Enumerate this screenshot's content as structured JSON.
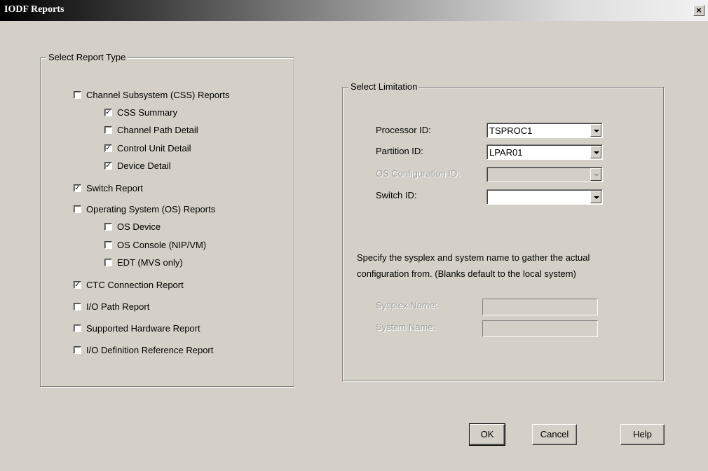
{
  "window": {
    "title": "IODF Reports",
    "close_glyph": "×"
  },
  "report_type": {
    "group_label": "Select Report Type",
    "items": [
      {
        "label": "Channel Subsystem (CSS) Reports",
        "checked": false
      },
      {
        "label": "CSS Summary",
        "checked": true
      },
      {
        "label": "Channel Path Detail",
        "checked": false
      },
      {
        "label": "Control Unit Detail",
        "checked": true
      },
      {
        "label": "Device Detail",
        "checked": true
      },
      {
        "label": "Switch Report",
        "checked": true
      },
      {
        "label": "Operating System (OS) Reports",
        "checked": false
      },
      {
        "label": "OS Device",
        "checked": false
      },
      {
        "label": "OS Console (NIP/VM)",
        "checked": false
      },
      {
        "label": "EDT (MVS only)",
        "checked": false
      },
      {
        "label": "CTC Connection Report",
        "checked": true
      },
      {
        "label": "I/O Path Report",
        "checked": false
      },
      {
        "label": "Supported Hardware Report",
        "checked": false
      },
      {
        "label": "I/O Definition Reference Report",
        "checked": false
      }
    ]
  },
  "limitation": {
    "group_label": "Select Limitation",
    "processor_label": "Processor ID:",
    "processor_value": "TSPROC1",
    "partition_label": "Partition ID:",
    "partition_value": "LPAR01",
    "os_config_label": "OS Configuration ID:",
    "os_config_value": "",
    "switch_label": "Switch ID:",
    "switch_value": "",
    "note_line1": "Specify the sysplex and system name to gather the actual",
    "note_line2": "configuration from. (Blanks default to the local system)",
    "sysplex_label": "Sysplex Name:",
    "sysplex_value": "",
    "system_label": "System Name:",
    "system_value": ""
  },
  "buttons": {
    "ok": "OK",
    "cancel": "Cancel",
    "help": "Help"
  }
}
